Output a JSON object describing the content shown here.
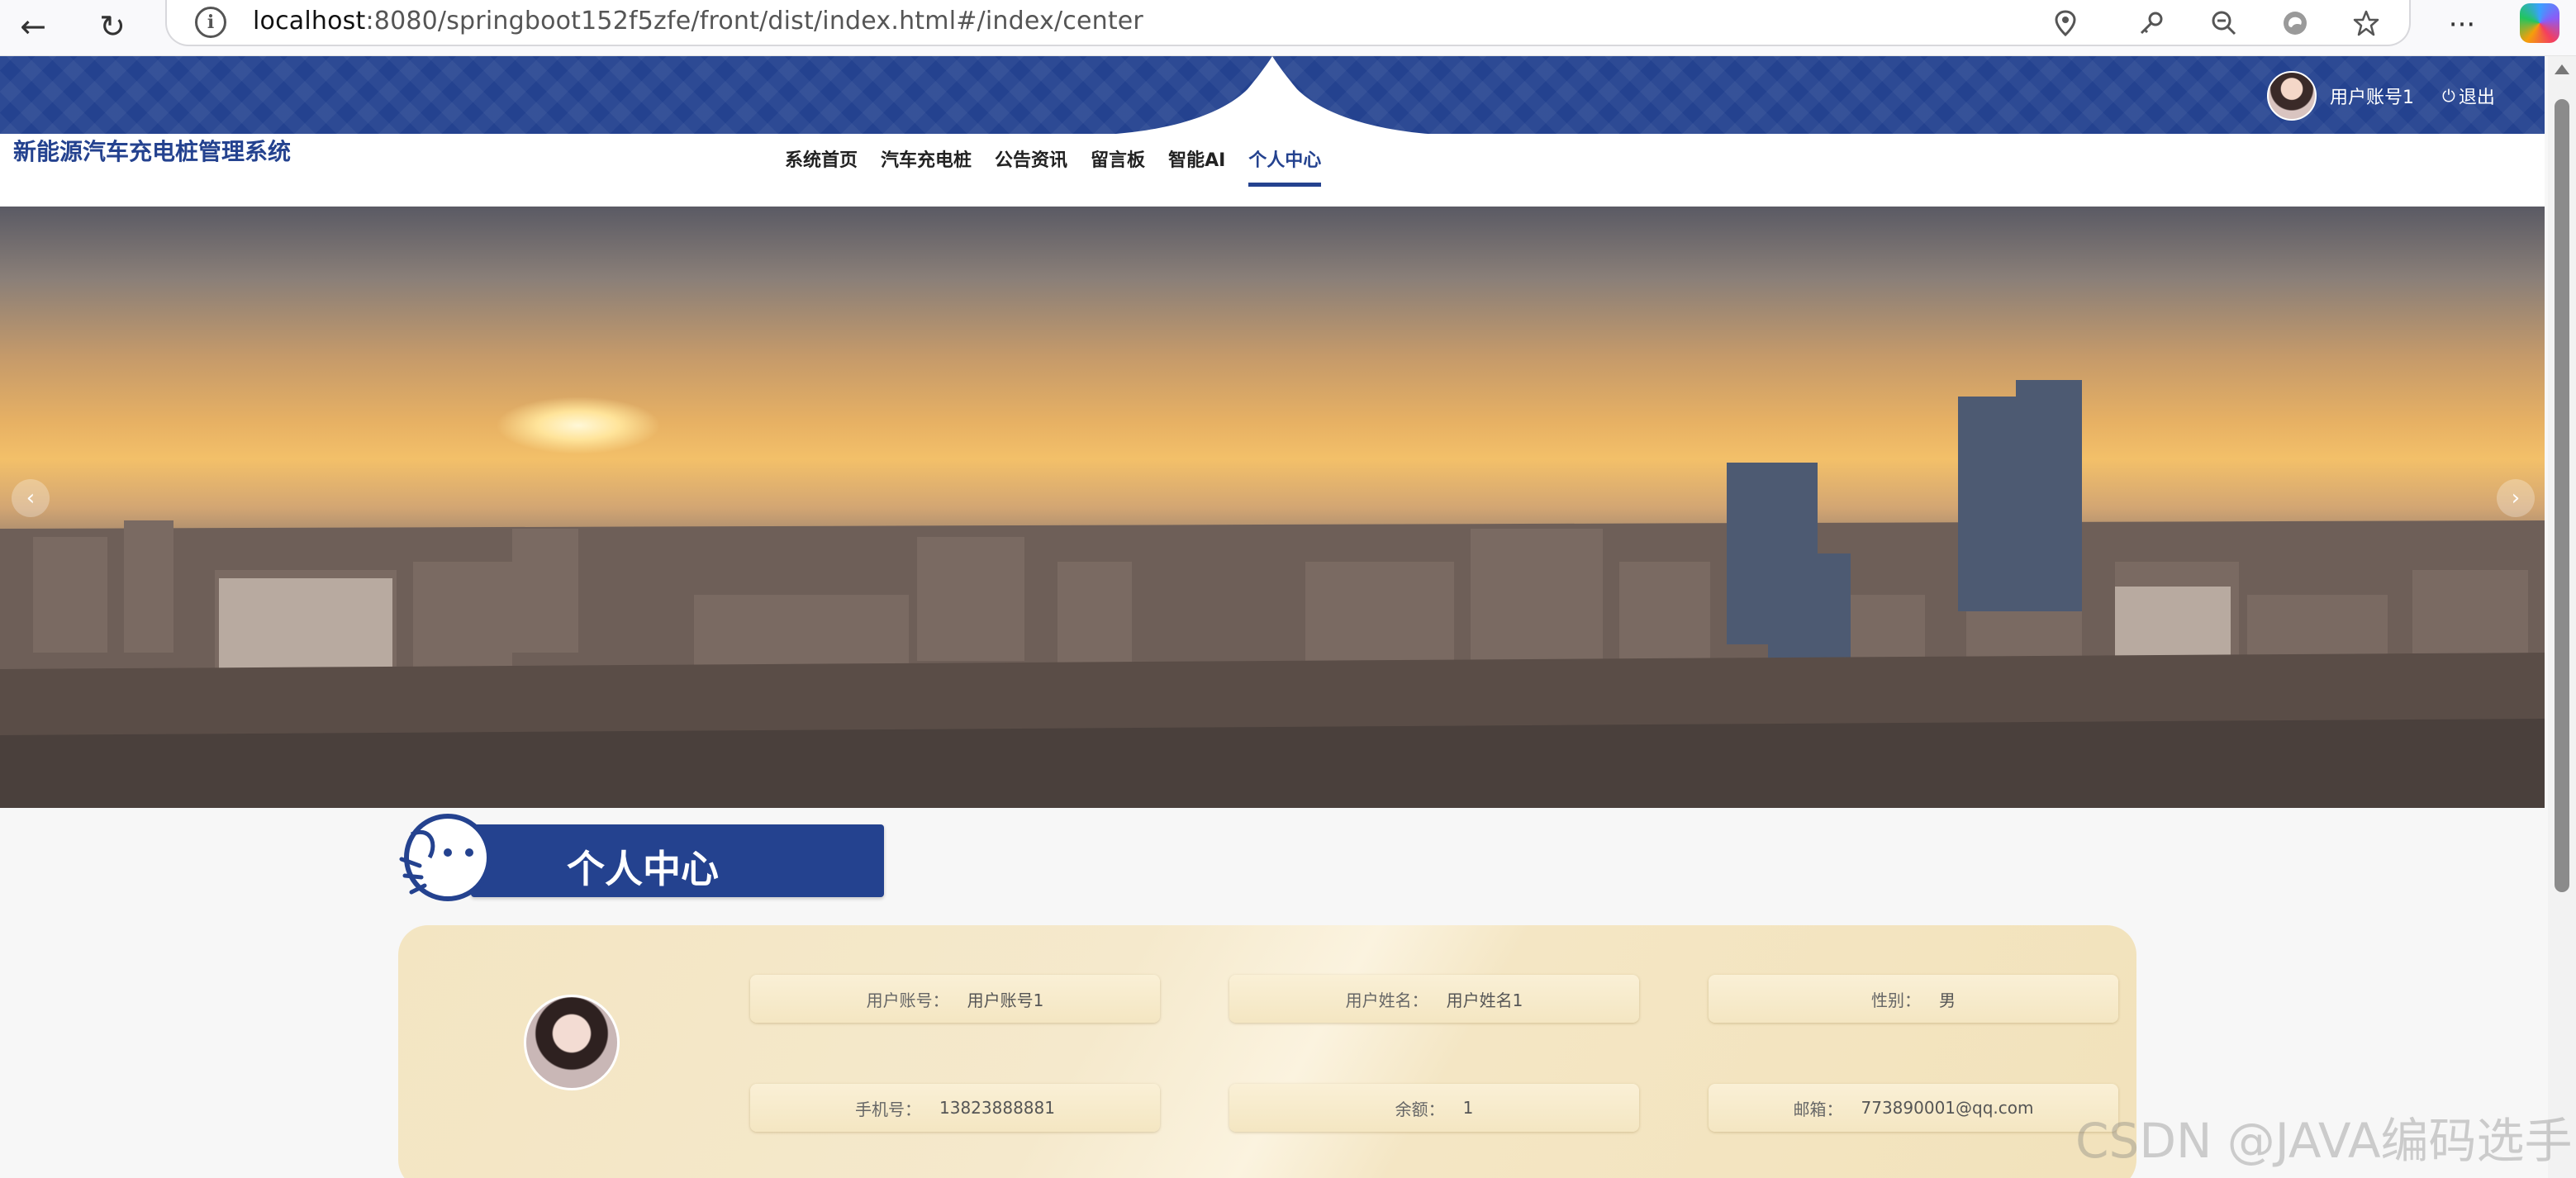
{
  "browser": {
    "url_host": "localhost",
    "url_rest": ":8080/springboot152f5zfe/front/dist/index.html#/index/center",
    "icons": [
      "back-icon",
      "reload-icon",
      "info-icon",
      "location-icon",
      "key-icon",
      "zoom-out-icon",
      "edge-refresh-icon",
      "favorite-star-icon",
      "more-icon",
      "copilot-icon"
    ]
  },
  "header": {
    "user_name": "用户账号1",
    "logout_label": "退出"
  },
  "site": {
    "title": "新能源汽车充电桩管理系统"
  },
  "nav": {
    "items": [
      {
        "label": "系统首页"
      },
      {
        "label": "汽车充电桩"
      },
      {
        "label": "公告资讯"
      },
      {
        "label": "留言板"
      },
      {
        "label": "智能AI"
      },
      {
        "label": "个人中心",
        "active": true
      }
    ]
  },
  "banner": {
    "prev_label": "‹",
    "next_label": "›"
  },
  "section": {
    "title": "个人中心"
  },
  "profile": {
    "fields": [
      {
        "label": "用户账号：",
        "value": "用户账号1"
      },
      {
        "label": "用户姓名：",
        "value": "用户姓名1"
      },
      {
        "label": "性别：",
        "value": "男"
      },
      {
        "label": "手机号：",
        "value": "13823888881"
      },
      {
        "label": "余额：",
        "value": "1"
      },
      {
        "label": "邮箱：",
        "value": "773890001@qq.com"
      }
    ]
  },
  "watermark": "CSDN @JAVA编码选手",
  "colors": {
    "primary": "#24428f",
    "card": "#f3e5c2",
    "page_bg": "#f7f7f7"
  }
}
